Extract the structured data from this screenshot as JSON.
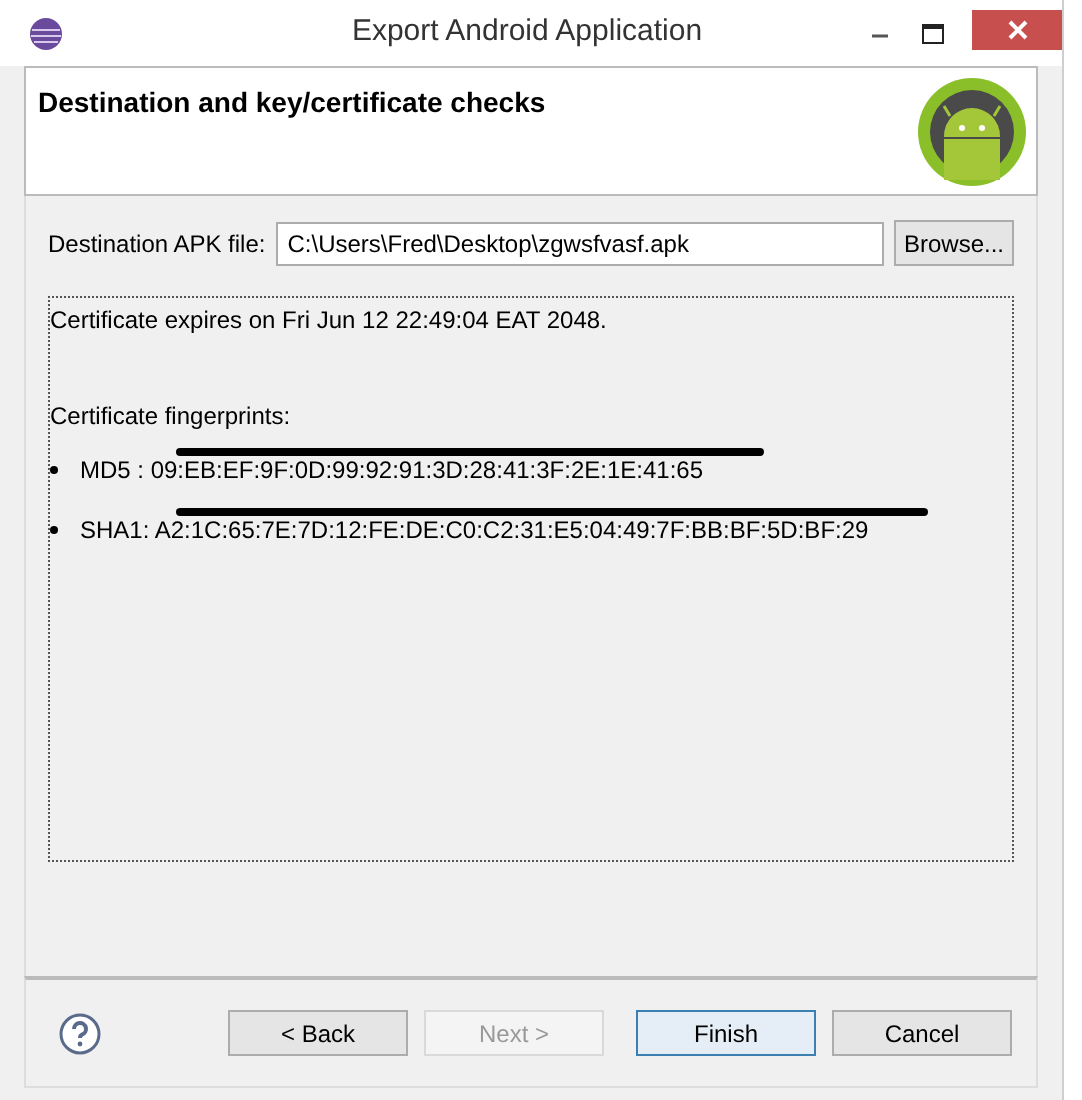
{
  "window": {
    "title": "Export Android Application"
  },
  "header": {
    "title": "Destination and key/certificate checks"
  },
  "destination": {
    "label": "Destination APK file:",
    "value": "C:\\Users\\Fred\\Desktop\\zgwsfvasf.apk",
    "browse": "Browse..."
  },
  "details": {
    "expiry": "Certificate expires on Fri Jun 12 22:49:04 EAT 2048.",
    "fingerprints_title": "Certificate fingerprints:",
    "fingerprints": [
      {
        "text": "MD5 : 09:EB:EF:9F:0D:99:92:91:3D:28:41:3F:2E:1E:41:65",
        "redacted": true
      },
      {
        "text": "SHA1: A2:1C:65:7E:7D:12:FE:DE:C0:C2:31:E5:04:49:7F:BB:BF:5D:BF:29",
        "redacted": true
      }
    ]
  },
  "buttons": [
    {
      "label": "< Back",
      "disabled": false,
      "default": false
    },
    {
      "label": "Next >",
      "disabled": true,
      "default": false
    },
    {
      "label": "Finish",
      "disabled": false,
      "default": true
    },
    {
      "label": "Cancel",
      "disabled": false,
      "default": false
    }
  ]
}
